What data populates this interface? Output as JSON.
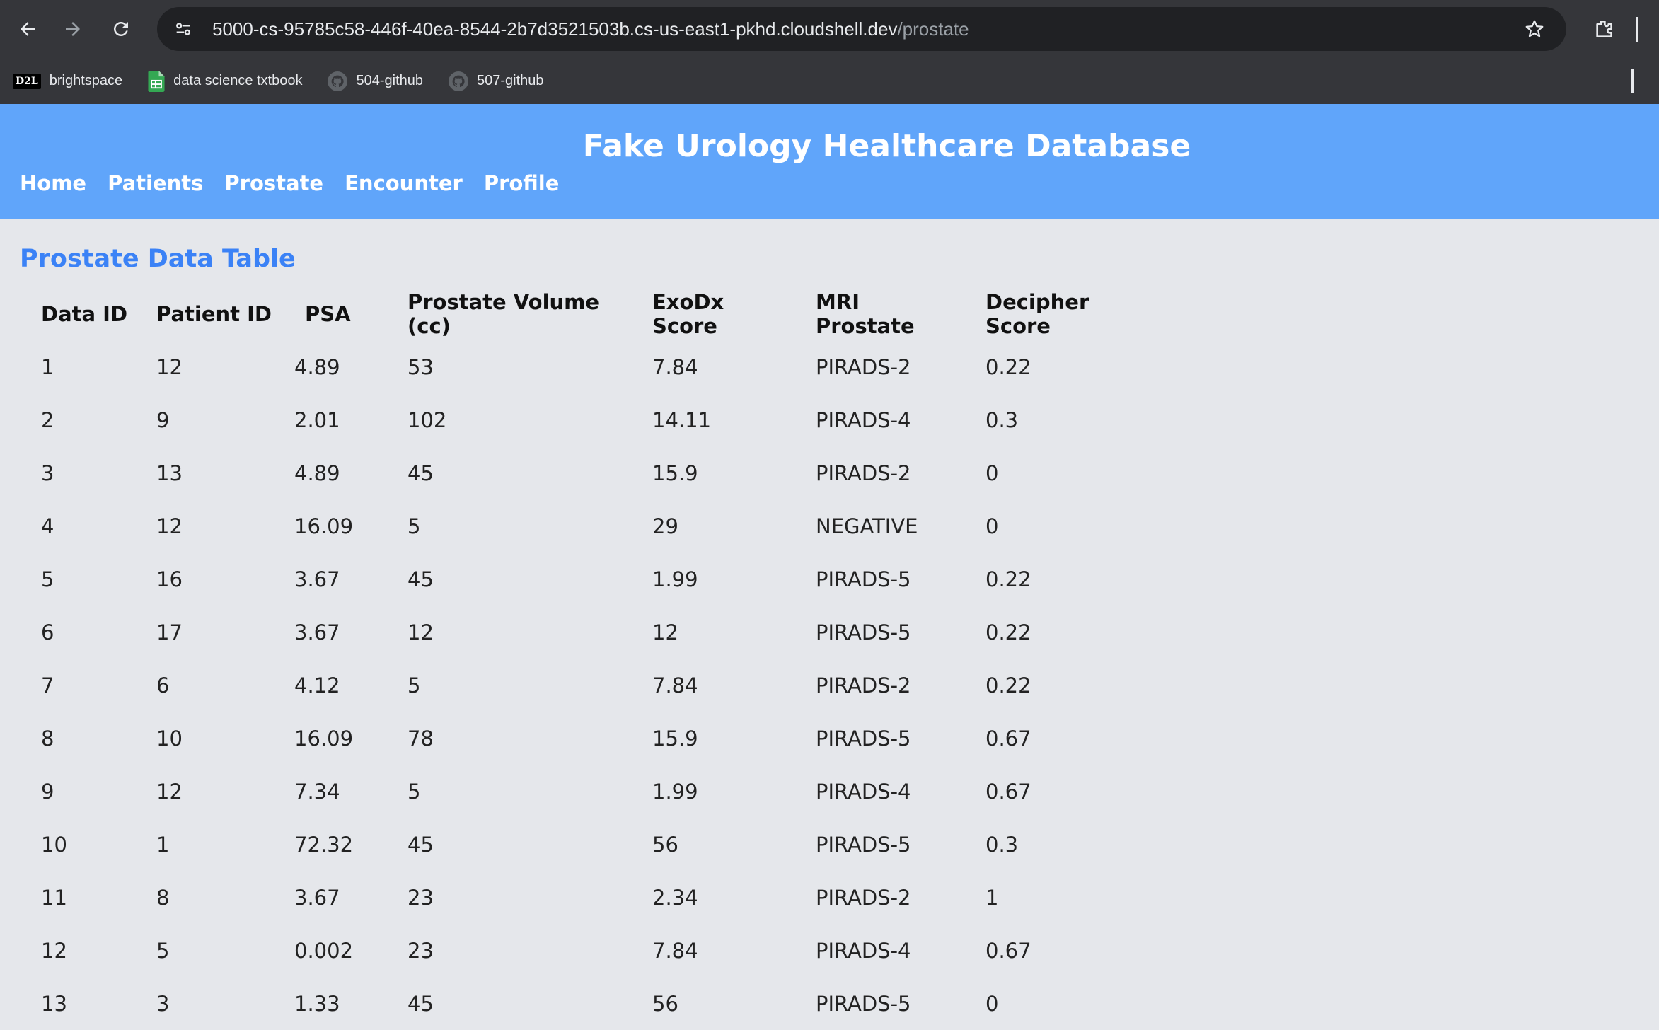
{
  "browser": {
    "url_host": "5000-cs-95785c58-446f-40ea-8544-2b7d3521503b.cs-us-east1-pkhd.cloudshell.dev",
    "url_path": "/prostate",
    "bookmarks": [
      {
        "label": "brightspace",
        "icon": "d2l-icon",
        "icon_text": "D2L"
      },
      {
        "label": "data science txtbook",
        "icon": "sheets-icon"
      },
      {
        "label": "504-github",
        "icon": "github-icon"
      },
      {
        "label": "507-github",
        "icon": "github-icon"
      }
    ]
  },
  "header": {
    "title": "Fake Urology Healthcare Database",
    "nav": [
      "Home",
      "Patients",
      "Prostate",
      "Encounter",
      "Profile"
    ],
    "background": "#60a5fa"
  },
  "main": {
    "section_title": "Prostate Data Table",
    "accent": "#3b82f6",
    "columns": [
      "Data ID",
      "Patient ID",
      "PSA",
      "Prostate Volume (cc)",
      "ExoDx Score",
      "MRI Prostate",
      "Decipher Score"
    ],
    "rows": [
      [
        "1",
        "12",
        "4.89",
        "53",
        "7.84",
        "PIRADS-2",
        "0.22"
      ],
      [
        "2",
        "9",
        "2.01",
        "102",
        "14.11",
        "PIRADS-4",
        "0.3"
      ],
      [
        "3",
        "13",
        "4.89",
        "45",
        "15.9",
        "PIRADS-2",
        "0"
      ],
      [
        "4",
        "12",
        "16.09",
        "5",
        "29",
        "NEGATIVE",
        "0"
      ],
      [
        "5",
        "16",
        "3.67",
        "45",
        "1.99",
        "PIRADS-5",
        "0.22"
      ],
      [
        "6",
        "17",
        "3.67",
        "12",
        "12",
        "PIRADS-5",
        "0.22"
      ],
      [
        "7",
        "6",
        "4.12",
        "5",
        "7.84",
        "PIRADS-2",
        "0.22"
      ],
      [
        "8",
        "10",
        "16.09",
        "78",
        "15.9",
        "PIRADS-5",
        "0.67"
      ],
      [
        "9",
        "12",
        "7.34",
        "5",
        "1.99",
        "PIRADS-4",
        "0.67"
      ],
      [
        "10",
        "1",
        "72.32",
        "45",
        "56",
        "PIRADS-5",
        "0.3"
      ],
      [
        "11",
        "8",
        "3.67",
        "23",
        "2.34",
        "PIRADS-2",
        "1"
      ],
      [
        "12",
        "5",
        "0.002",
        "23",
        "7.84",
        "PIRADS-4",
        "0.67"
      ],
      [
        "13",
        "3",
        "1.33",
        "45",
        "56",
        "PIRADS-5",
        "0"
      ]
    ]
  }
}
